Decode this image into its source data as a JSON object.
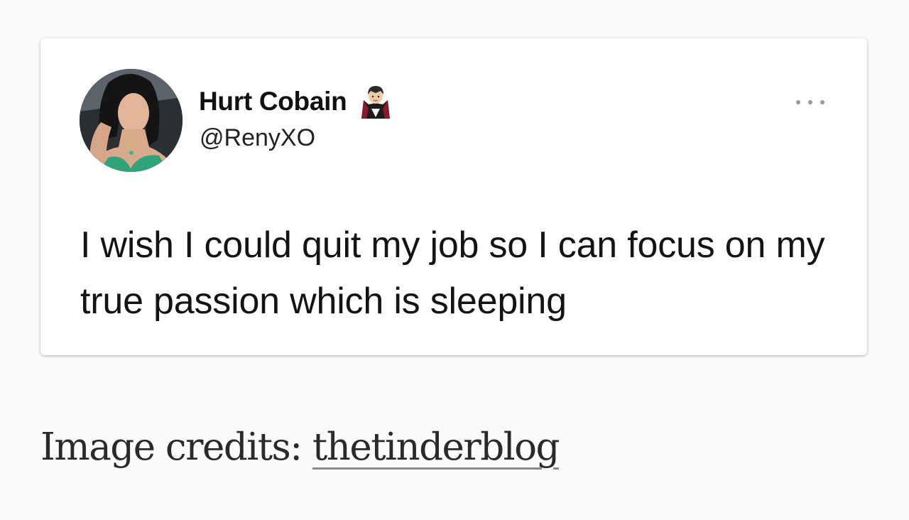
{
  "tweet": {
    "display_name": "Hurt Cobain",
    "display_name_emoji": "vampire-icon",
    "handle": "@RenyXO",
    "text": "I wish I could quit my job so I can focus on my true passion which is sleeping",
    "more_icon": "more-options-icon",
    "avatar_icon": "profile-photo"
  },
  "credits": {
    "label": "Image credits: ",
    "link_text": "thetinderblog"
  },
  "colors": {
    "page_background": "#fafafa",
    "card_background": "#ffffff",
    "text": "#141414",
    "link_underline": "#8a8a8a"
  }
}
